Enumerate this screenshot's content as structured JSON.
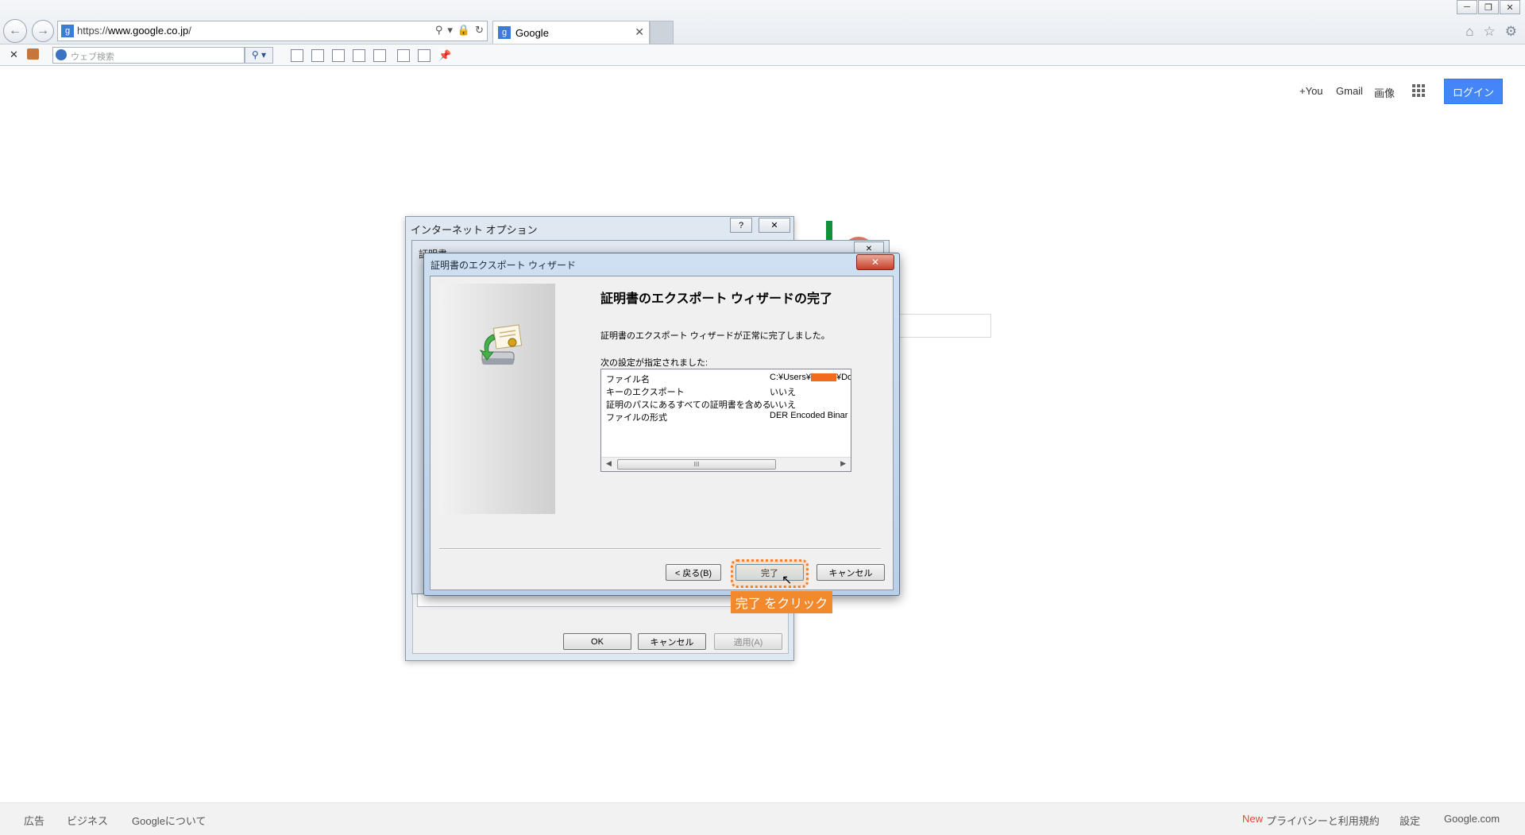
{
  "browser": {
    "url_prefix": "https://",
    "url_domain": "www.google.co.jp",
    "url_suffix": "/",
    "tab_title": "Google",
    "search_placeholder": "ウェブ検索"
  },
  "google": {
    "links": [
      "+You",
      "Gmail",
      "画像"
    ],
    "login": "ログイン",
    "footer_left": [
      "広告",
      "ビジネス",
      "Googleについて"
    ],
    "footer_new": "New",
    "footer_right": [
      "プライバシーと利用規約",
      "設定",
      "Google.com"
    ]
  },
  "inet_options": {
    "title": "インターネット オプション",
    "help": "?",
    "ok": "OK",
    "cancel": "キャンセル",
    "apply": "適用(A)"
  },
  "cert_window": {
    "title": "証明書"
  },
  "wizard": {
    "title": "証明書のエクスポート ウィザード",
    "heading": "証明書のエクスポート ウィザードの完了",
    "message": "証明書のエクスポート ウィザードが正常に完了しました。",
    "settings_label": "次の設定が指定されました:",
    "settings": [
      {
        "key": "ファイル名",
        "value_pre": "C:¥Users¥",
        "value_post": "¥Dow"
      },
      {
        "key": "キーのエクスポート",
        "value": "いいえ"
      },
      {
        "key": "証明のパスにあるすべての証明書を含める",
        "value": "いいえ"
      },
      {
        "key": "ファイルの形式",
        "value": "DER Encoded Binar"
      }
    ],
    "back": "< 戻る(B)",
    "finish": "完了",
    "cancel": "キャンセル",
    "scroll_grip": "III"
  },
  "annotation": "完了 をクリック",
  "colors": {
    "login_bg": "#4486f6",
    "highlight": "#f0822e",
    "annotation_bg": "#f28a2d",
    "redaction": "#f26a1b"
  }
}
